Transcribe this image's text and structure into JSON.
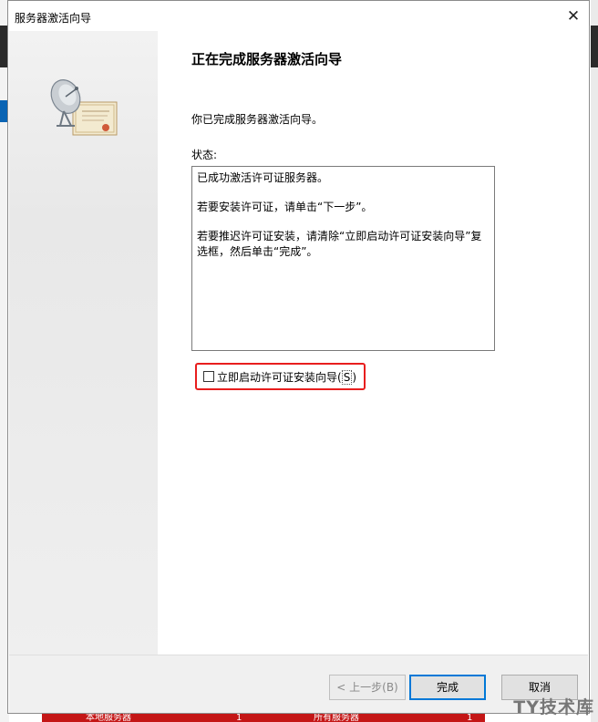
{
  "window": {
    "title": "服务器激活向导",
    "close_glyph": "✕"
  },
  "page": {
    "heading": "正在完成服务器激活向导",
    "intro": "你已完成服务器激活向导。",
    "status_label": "状态:",
    "status_lines": [
      "已成功激活许可证服务器。",
      "若要安装许可证，请单击“下一步”。",
      "若要推迟许可证安装，请清除“立即启动许可证安装向导”复选框，然后单击“完成”。"
    ],
    "checkbox": {
      "label_prefix": "立即启动许可证安装向导(",
      "mnemonic": "S",
      "label_suffix": ")",
      "checked": false
    }
  },
  "buttons": {
    "back": "< 上一步(B)",
    "finish": "完成",
    "cancel": "取消"
  },
  "taskbar": {
    "left_label": "本地服务器",
    "left_count": "1",
    "right_label": "所有服务器",
    "right_count": "1"
  },
  "watermark": "TY技术库",
  "colors": {
    "highlight": "#e81e1e",
    "default_button_border": "#0078d7",
    "strip": "#c41616"
  },
  "icons": {
    "wizard_graphic": "satellite-dish-certificate-icon",
    "close": "close-icon"
  }
}
